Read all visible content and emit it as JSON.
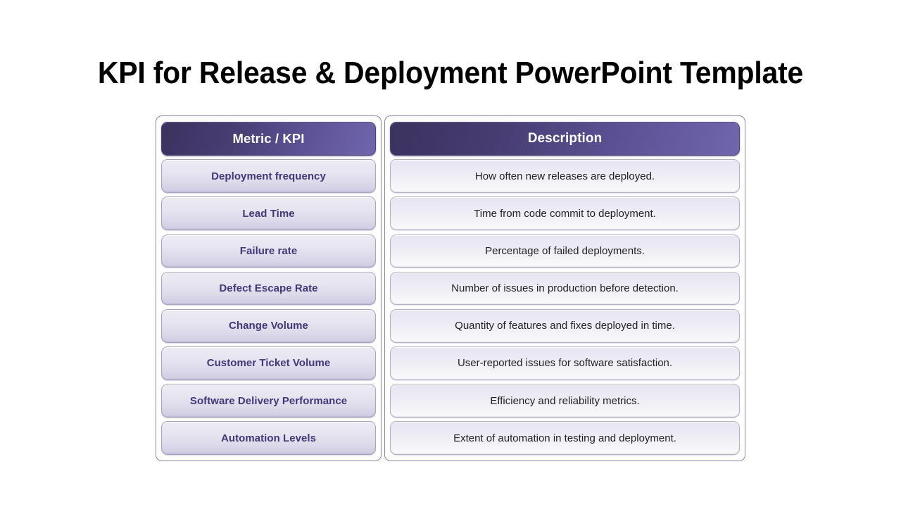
{
  "slide": {
    "title": "KPI for Release & Deployment PowerPoint Template",
    "background_color": "#ffffff"
  },
  "theme": {
    "header_gradient_dark": "#3b325f",
    "header_gradient_light": "#7066ad",
    "header_text_color": "#ffffff",
    "metric_text_color": "#413876",
    "description_text_color": "#222222",
    "border_color": "#8a82ab"
  },
  "table": {
    "headers": {
      "metric": "Metric / KPI",
      "description": "Description"
    },
    "rows": [
      {
        "metric": "Deployment frequency",
        "description": "How often new releases are deployed."
      },
      {
        "metric": "Lead Time",
        "description": "Time from code commit to deployment."
      },
      {
        "metric": "Failure rate",
        "description": "Percentage of failed deployments."
      },
      {
        "metric": "Defect Escape Rate",
        "description": "Number of issues in production before detection."
      },
      {
        "metric": "Change Volume",
        "description": "Quantity of features and fixes deployed in time."
      },
      {
        "metric": "Customer Ticket Volume",
        "description": "User-reported issues for software satisfaction."
      },
      {
        "metric": "Software Delivery Performance",
        "description": "Efficiency and reliability metrics."
      },
      {
        "metric": "Automation Levels",
        "description": "Extent of automation in testing and deployment."
      }
    ]
  }
}
